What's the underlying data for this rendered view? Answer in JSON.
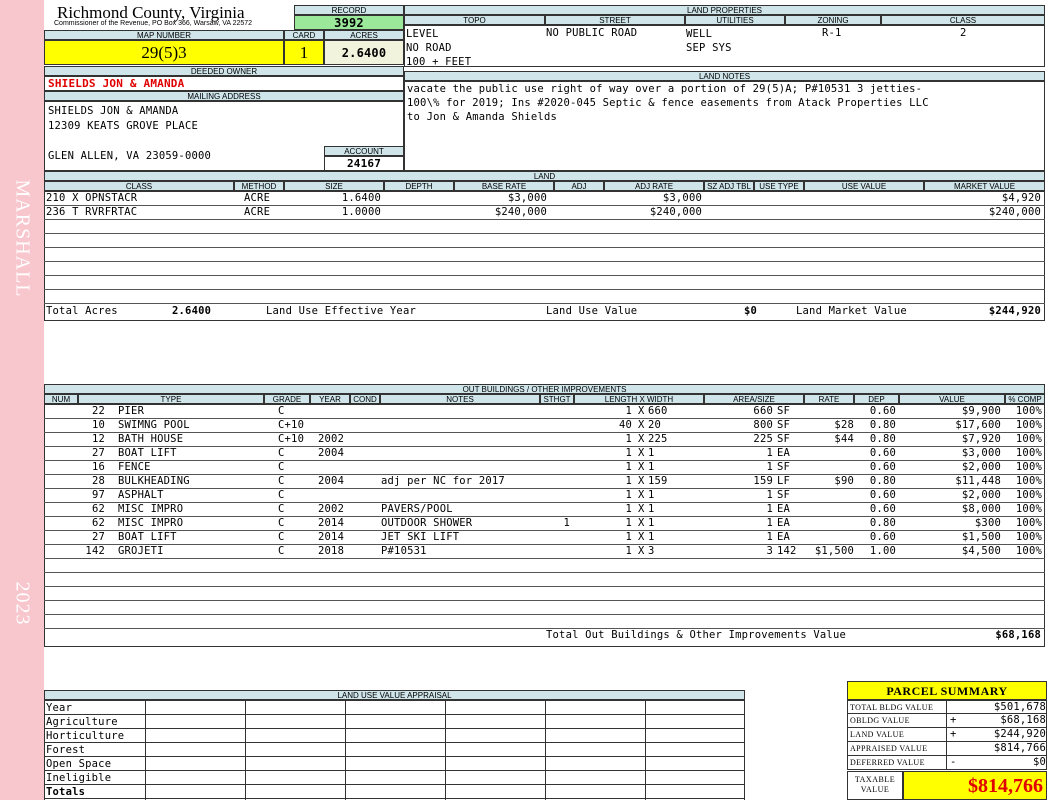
{
  "sidebar": {
    "district": "MARSHALL",
    "year": "2023"
  },
  "header": {
    "county": "Richmond County, Virginia",
    "commissioner": "Commissioner of the Revenue, PO Box 366, Warsaw, VA 22572",
    "record_label": "RECORD",
    "record": "3992",
    "map_label": "MAP NUMBER",
    "map_number": "29(5)3",
    "card_label": "CARD",
    "card": "1",
    "acres_label": "ACRES",
    "acres": "2.6400"
  },
  "owner": {
    "deeded_label": "DEEDED OWNER",
    "deeded_owner": "SHIELDS JON & AMANDA",
    "mailing_label": "MAILING ADDRESS",
    "mailing_lines": [
      "SHIELDS JON & AMANDA",
      "12309 KEATS GROVE PLACE",
      "",
      "GLEN ALLEN, VA 23059-0000"
    ],
    "account_label": "ACCOUNT",
    "account": "24167"
  },
  "land_properties": {
    "title": "LAND PROPERTIES",
    "headers": [
      "TOPO",
      "STREET",
      "UTILITIES",
      "ZONING",
      "CLASS"
    ],
    "topo": [
      "LEVEL",
      "NO ROAD",
      "100 + FEET"
    ],
    "street": [
      "NO PUBLIC ROAD"
    ],
    "utilities": [
      "WELL",
      "SEP SYS"
    ],
    "zoning": "R-1",
    "class": "2"
  },
  "land_notes": {
    "title": "LAND NOTES",
    "lines": [
      "vacate the public use right of way over a portion of 29(5)A; P#10531 3 jetties-",
      "100\\% for 2019; Ins #2020-045 Septic & fence easements from Atack Properties LLC",
      "to Jon & Amanda Shields"
    ]
  },
  "land": {
    "title": "LAND",
    "headers": [
      "CLASS",
      "METHOD",
      "SIZE",
      "DEPTH",
      "BASE RATE",
      "ADJ",
      "ADJ RATE",
      "SZ ADJ TBL",
      "USE TYPE",
      "USE VALUE",
      "MARKET VALUE"
    ],
    "rows": [
      {
        "class": "210 X OPNSTACR",
        "method": "ACRE",
        "size": "1.6400",
        "depth": "",
        "base_rate": "$3,000",
        "adj": "",
        "adj_rate": "$3,000",
        "sz": "",
        "use_type": "",
        "use_value": "",
        "market": "$4,920"
      },
      {
        "class": "236 T RVRFRTAC",
        "method": "ACRE",
        "size": "1.0000",
        "depth": "",
        "base_rate": "$240,000",
        "adj": "",
        "adj_rate": "$240,000",
        "sz": "",
        "use_type": "",
        "use_value": "",
        "market": "$240,000"
      }
    ],
    "total_acres_label": "Total Acres",
    "total_acres": "2.6400",
    "luey_label": "Land Use Effective Year",
    "luv_label": "Land Use Value",
    "luv": "$0",
    "lmv_label": "Land Market Value",
    "lmv": "$244,920"
  },
  "outbuildings": {
    "title": "OUT BUILDINGS / OTHER IMPROVEMENTS",
    "headers": [
      "NUM",
      "TYPE",
      "GRADE",
      "YEAR",
      "COND",
      "NOTES",
      "STHGT",
      "LENGTH X WIDTH",
      "AREA/SIZE",
      "RATE",
      "DEP",
      "VALUE",
      "% COMP"
    ],
    "rows": [
      {
        "num": "22",
        "type": "PIER",
        "grade": "C",
        "year": "",
        "notes": "",
        "sthgt": "",
        "l": "1",
        "w": "660",
        "area": "660",
        "unit": "SF",
        "rate": "",
        "dep": "0.60",
        "value": "$9,900",
        "comp": "100%"
      },
      {
        "num": "10",
        "type": "SWIMNG POOL",
        "grade": "C+10",
        "year": "",
        "notes": "",
        "sthgt": "",
        "l": "40",
        "w": "20",
        "area": "800",
        "unit": "SF",
        "rate": "$28",
        "dep": "0.80",
        "value": "$17,600",
        "comp": "100%"
      },
      {
        "num": "12",
        "type": "BATH HOUSE",
        "grade": "C+10",
        "year": "2002",
        "notes": "",
        "sthgt": "",
        "l": "1",
        "w": "225",
        "area": "225",
        "unit": "SF",
        "rate": "$44",
        "dep": "0.80",
        "value": "$7,920",
        "comp": "100%"
      },
      {
        "num": "27",
        "type": "BOAT LIFT",
        "grade": "C",
        "year": "2004",
        "notes": "",
        "sthgt": "",
        "l": "1",
        "w": "1",
        "area": "1",
        "unit": "EA",
        "rate": "",
        "dep": "0.60",
        "value": "$3,000",
        "comp": "100%"
      },
      {
        "num": "16",
        "type": "FENCE",
        "grade": "C",
        "year": "",
        "notes": "",
        "sthgt": "",
        "l": "1",
        "w": "1",
        "area": "1",
        "unit": "SF",
        "rate": "",
        "dep": "0.60",
        "value": "$2,000",
        "comp": "100%"
      },
      {
        "num": "28",
        "type": "BULKHEADING",
        "grade": "C",
        "year": "2004",
        "notes": "adj per NC for 2017",
        "sthgt": "",
        "l": "1",
        "w": "159",
        "area": "159",
        "unit": "LF",
        "rate": "$90",
        "dep": "0.80",
        "value": "$11,448",
        "comp": "100%"
      },
      {
        "num": "97",
        "type": "ASPHALT",
        "grade": "C",
        "year": "",
        "notes": "",
        "sthgt": "",
        "l": "1",
        "w": "1",
        "area": "1",
        "unit": "SF",
        "rate": "",
        "dep": "0.60",
        "value": "$2,000",
        "comp": "100%"
      },
      {
        "num": "62",
        "type": "MISC IMPRO",
        "grade": "C",
        "year": "2002",
        "notes": "PAVERS/POOL",
        "sthgt": "",
        "l": "1",
        "w": "1",
        "area": "1",
        "unit": "EA",
        "rate": "",
        "dep": "0.60",
        "value": "$8,000",
        "comp": "100%"
      },
      {
        "num": "62",
        "type": "MISC IMPRO",
        "grade": "C",
        "year": "2014",
        "notes": "OUTDOOR SHOWER",
        "sthgt": "1",
        "l": "1",
        "w": "1",
        "area": "1",
        "unit": "EA",
        "rate": "",
        "dep": "0.80",
        "value": "$300",
        "comp": "100%"
      },
      {
        "num": "27",
        "type": "BOAT LIFT",
        "grade": "C",
        "year": "2014",
        "notes": "JET SKI LIFT",
        "sthgt": "",
        "l": "1",
        "w": "1",
        "area": "1",
        "unit": "EA",
        "rate": "",
        "dep": "0.60",
        "value": "$1,500",
        "comp": "100%"
      },
      {
        "num": "142",
        "type": "GROJETI",
        "grade": "C",
        "year": "2018",
        "notes": "P#10531",
        "sthgt": "",
        "l": "1",
        "w": "3",
        "area": "3",
        "unit": "142",
        "rate": "$1,500",
        "dep": "1.00",
        "value": "$4,500",
        "comp": "100%"
      }
    ],
    "total_label": "Total Out Buildings & Other Improvements Value",
    "total": "$68,168"
  },
  "luva": {
    "title": "LAND USE VALUE APPRAISAL",
    "rows": [
      "Year",
      "Agriculture",
      "Horticulture",
      "Forest",
      "Open Space",
      "Ineligible",
      "Totals"
    ]
  },
  "summary": {
    "title": "PARCEL SUMMARY",
    "rows": [
      {
        "label": "TOTAL BLDG VALUE",
        "sign": "",
        "value": "$501,678"
      },
      {
        "label": "OBLDG VALUE",
        "sign": "+",
        "value": "$68,168"
      },
      {
        "label": "LAND VALUE",
        "sign": "+",
        "value": "$244,920"
      },
      {
        "label": "APPRAISED VALUE",
        "sign": "",
        "value": "$814,766"
      },
      {
        "label": "DEFERRED VALUE",
        "sign": "-",
        "value": "$0"
      }
    ],
    "taxable_label_1": "TAXABLE",
    "taxable_label_2": "VALUE",
    "taxable_value": "$814,766"
  }
}
